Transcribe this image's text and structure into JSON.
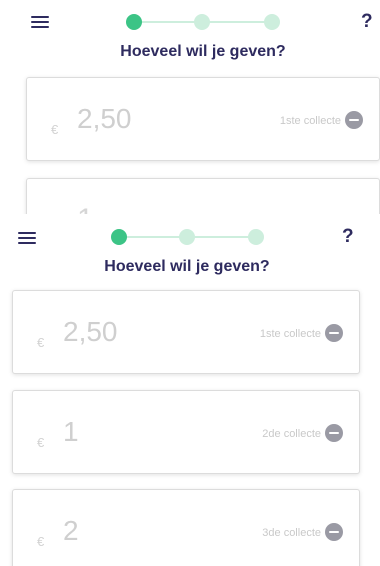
{
  "colors": {
    "accent": "#3cc486",
    "step_inactive": "#cdeedd",
    "title": "#2e2b5f",
    "placeholder_text": "#cfcfcf",
    "minus_icon": "#9a9aa4"
  },
  "icons": {
    "menu": "hamburger-menu-icon",
    "help": "question-mark-icon",
    "remove": "minus-circle-icon"
  },
  "header": {
    "title": "Hoeveel wil je geven?",
    "help_label": "?",
    "steps": {
      "total": 3,
      "active": 1
    }
  },
  "back_screen": {
    "cards": [
      {
        "currency": "€",
        "amount": "2,50",
        "label": "1ste collecte"
      },
      {
        "currency": "",
        "amount": "1",
        "label": ""
      }
    ]
  },
  "front_screen": {
    "cards": [
      {
        "currency": "€",
        "amount": "2,50",
        "label": "1ste collecte"
      },
      {
        "currency": "€",
        "amount": "1",
        "label": "2de collecte"
      },
      {
        "currency": "€",
        "amount": "2",
        "label": "3de collecte"
      }
    ]
  }
}
